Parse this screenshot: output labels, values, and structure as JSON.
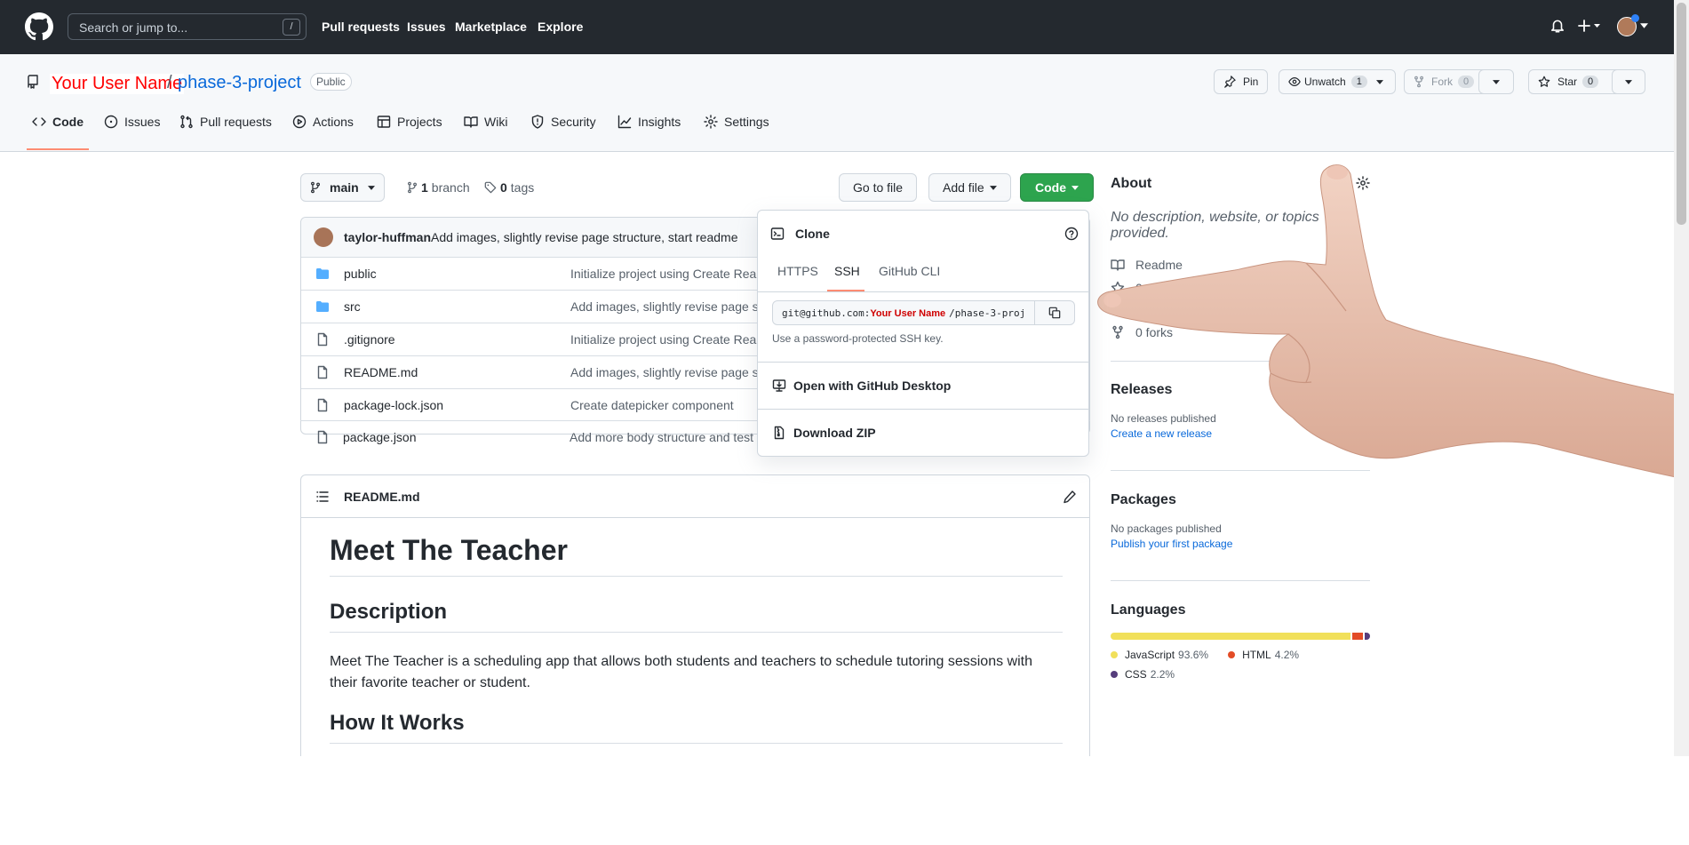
{
  "topbar": {
    "search_placeholder": "Search or jump to...",
    "slash_key": "/",
    "nav": [
      "Pull requests",
      "Issues",
      "Marketplace",
      "Explore"
    ]
  },
  "repo": {
    "owner": "Your User Name",
    "separator": "/",
    "name": "phase-3-project",
    "visibility": "Public",
    "pin_label": "Pin",
    "unwatch_label": "Unwatch",
    "unwatch_count": "1",
    "fork_label": "Fork",
    "fork_count": "0",
    "star_label": "Star",
    "star_count": "0"
  },
  "tabs": [
    "Code",
    "Issues",
    "Pull requests",
    "Actions",
    "Projects",
    "Wiki",
    "Security",
    "Insights",
    "Settings"
  ],
  "toolbar": {
    "branch": "main",
    "branch_count": "1",
    "branch_word": "branch",
    "tag_count": "0",
    "tag_word": "tags",
    "go_to_file": "Go to file",
    "add_file": "Add file",
    "code": "Code"
  },
  "commit": {
    "author": "taylor-huffman",
    "message": "Add images, slightly revise page structure, start readme"
  },
  "files": [
    {
      "name": "public",
      "type": "dir",
      "message": "Initialize project using Create Reac"
    },
    {
      "name": "src",
      "type": "dir",
      "message": "Add images, slightly revise page st"
    },
    {
      "name": ".gitignore",
      "type": "file",
      "message": "Initialize project using Create Reac"
    },
    {
      "name": "README.md",
      "type": "file",
      "message": "Add images, slightly revise page st"
    },
    {
      "name": "package-lock.json",
      "type": "file",
      "message": "Create datepicker component"
    },
    {
      "name": "package.json",
      "type": "file",
      "message": "Add more body structure and test"
    }
  ],
  "clone": {
    "title": "Clone",
    "tabs": [
      "HTTPS",
      "SSH",
      "GitHub CLI"
    ],
    "active_tab": "SSH",
    "url_prefix": "git@github.com:",
    "url_user": "Your User Name",
    "url_suffix": "/phase-3-proj",
    "hint": "Use a password-protected SSH key.",
    "desktop": "Open with GitHub Desktop",
    "zip": "Download ZIP"
  },
  "readme": {
    "filename": "README.md",
    "h1": "Meet The Teacher",
    "h2_description": "Description",
    "paragraph": "Meet The Teacher is a scheduling app that allows both students and teachers to schedule tutoring sessions with their favorite teacher or student.",
    "h2_how": "How It Works"
  },
  "about": {
    "title": "About",
    "description": "No description, website, or topics provided.",
    "readme": "Readme",
    "stars": "0 stars",
    "forks": "0 forks"
  },
  "releases": {
    "title": "Releases",
    "none": "No releases published",
    "create": "Create a new release"
  },
  "packages": {
    "title": "Packages",
    "none": "No packages published",
    "publish": "Publish your first package"
  },
  "languages": {
    "title": "Languages",
    "items": [
      {
        "name": "JavaScript",
        "percent": "93.6%",
        "value": 93.6,
        "color": "#f1e05a"
      },
      {
        "name": "HTML",
        "percent": "4.2%",
        "value": 4.2,
        "color": "#e34c26"
      },
      {
        "name": "CSS",
        "percent": "2.2%",
        "value": 2.2,
        "color": "#563d7c"
      }
    ]
  },
  "colors": {
    "topbar": "#24292f",
    "accent": "#0969da",
    "green": "#2da44e",
    "owner_highlight": "#ff0000"
  }
}
